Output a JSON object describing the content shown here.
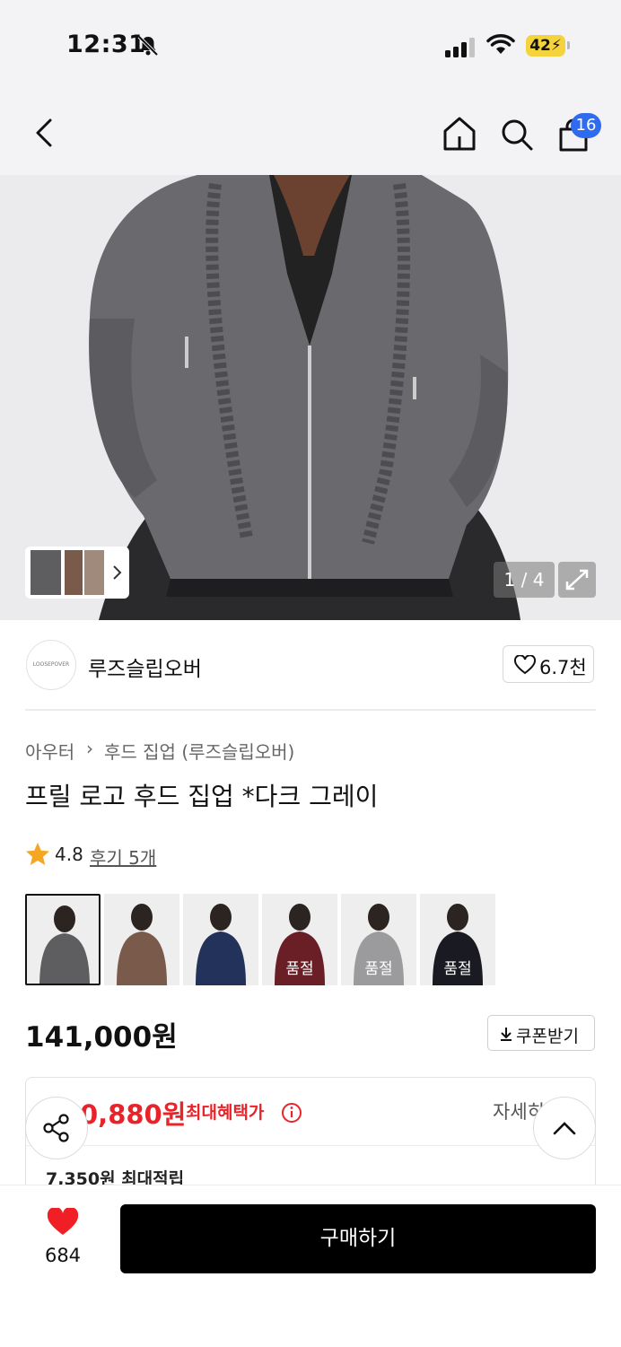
{
  "status_bar": {
    "time": "12:31",
    "battery": "42"
  },
  "header": {
    "cart_count": "16"
  },
  "hero": {
    "pager": "1 / 4"
  },
  "brand": {
    "logo_text": "LOOSEPOVER",
    "name": "루즈슬립오버",
    "likes": "6.7천"
  },
  "breadcrumb": {
    "category": "아우터",
    "separator": "›",
    "sub_category": "후드 집업 (루즈슬립오버)"
  },
  "product": {
    "title": "프릴 로고 후드 집업 *다크 그레이",
    "rating": "4.8",
    "review_link": "후기 5개",
    "price": "141,000원",
    "coupon_label": "쿠폰받기"
  },
  "variants": [
    {
      "label": "",
      "color": "#5e5d60",
      "selected": true
    },
    {
      "label": "",
      "color": "#7a5a4b",
      "selected": false
    },
    {
      "label": "",
      "color": "#23325a",
      "selected": false
    },
    {
      "label": "품절",
      "color": "#6a1f27",
      "selected": false
    },
    {
      "label": "품절",
      "color": "#9b9b9d",
      "selected": false
    },
    {
      "label": "품절",
      "color": "#1a1b22",
      "selected": false
    }
  ],
  "benefit": {
    "price": "0,880원",
    "label": "최대혜택가",
    "detail": "자세히",
    "points": "7,350원 최대적립"
  },
  "bottom": {
    "fav_count": "684",
    "buy_label": "구매하기"
  },
  "colors": {
    "accent_red": "#e8242a",
    "badge_blue": "#2f6bef",
    "battery_yellow": "#f4d33d"
  }
}
